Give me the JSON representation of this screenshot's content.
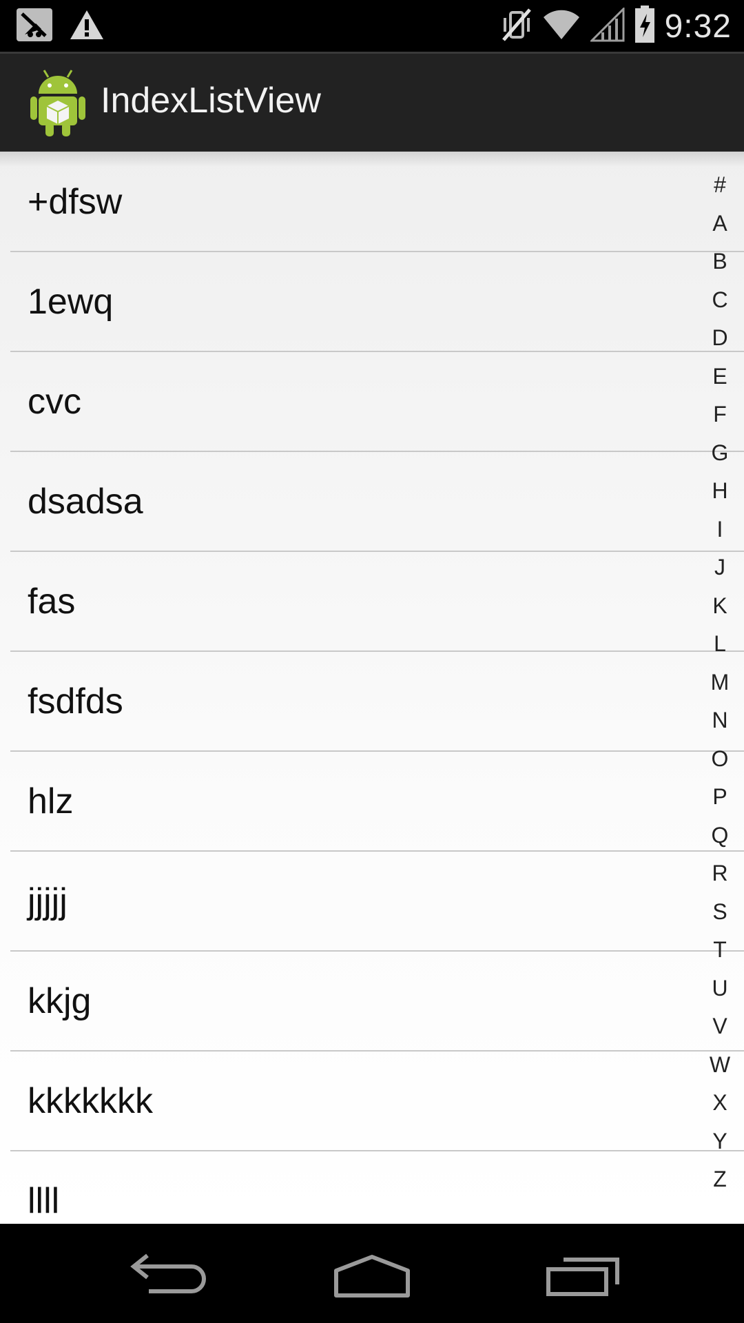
{
  "status_bar": {
    "time": "9:32",
    "icons": [
      "signal-off-icon",
      "warning-icon",
      "vibrate-off-icon",
      "wifi-icon",
      "cell-signal-icon",
      "battery-charging-icon"
    ]
  },
  "action_bar": {
    "title": "IndexListView",
    "icon": "android-app-icon"
  },
  "list": {
    "items": [
      {
        "label": "+dfsw"
      },
      {
        "label": "1ewq"
      },
      {
        "label": "cvc"
      },
      {
        "label": "dsadsa"
      },
      {
        "label": "fas"
      },
      {
        "label": "fsdfds"
      },
      {
        "label": "hlz"
      },
      {
        "label": "jjjjj"
      },
      {
        "label": "kkjg"
      },
      {
        "label": "kkkkkkk"
      },
      {
        "label": "llll"
      }
    ]
  },
  "index_bar": {
    "letters": [
      "#",
      "A",
      "B",
      "C",
      "D",
      "E",
      "F",
      "G",
      "H",
      "I",
      "J",
      "K",
      "L",
      "M",
      "N",
      "O",
      "P",
      "Q",
      "R",
      "S",
      "T",
      "U",
      "V",
      "W",
      "X",
      "Y",
      "Z"
    ]
  },
  "nav_bar": {
    "buttons": [
      "back-icon",
      "home-icon",
      "recents-icon"
    ]
  },
  "colors": {
    "status_bar_bg": "#000000",
    "action_bar_bg": "#222222",
    "android_green": "#9fc43a"
  }
}
